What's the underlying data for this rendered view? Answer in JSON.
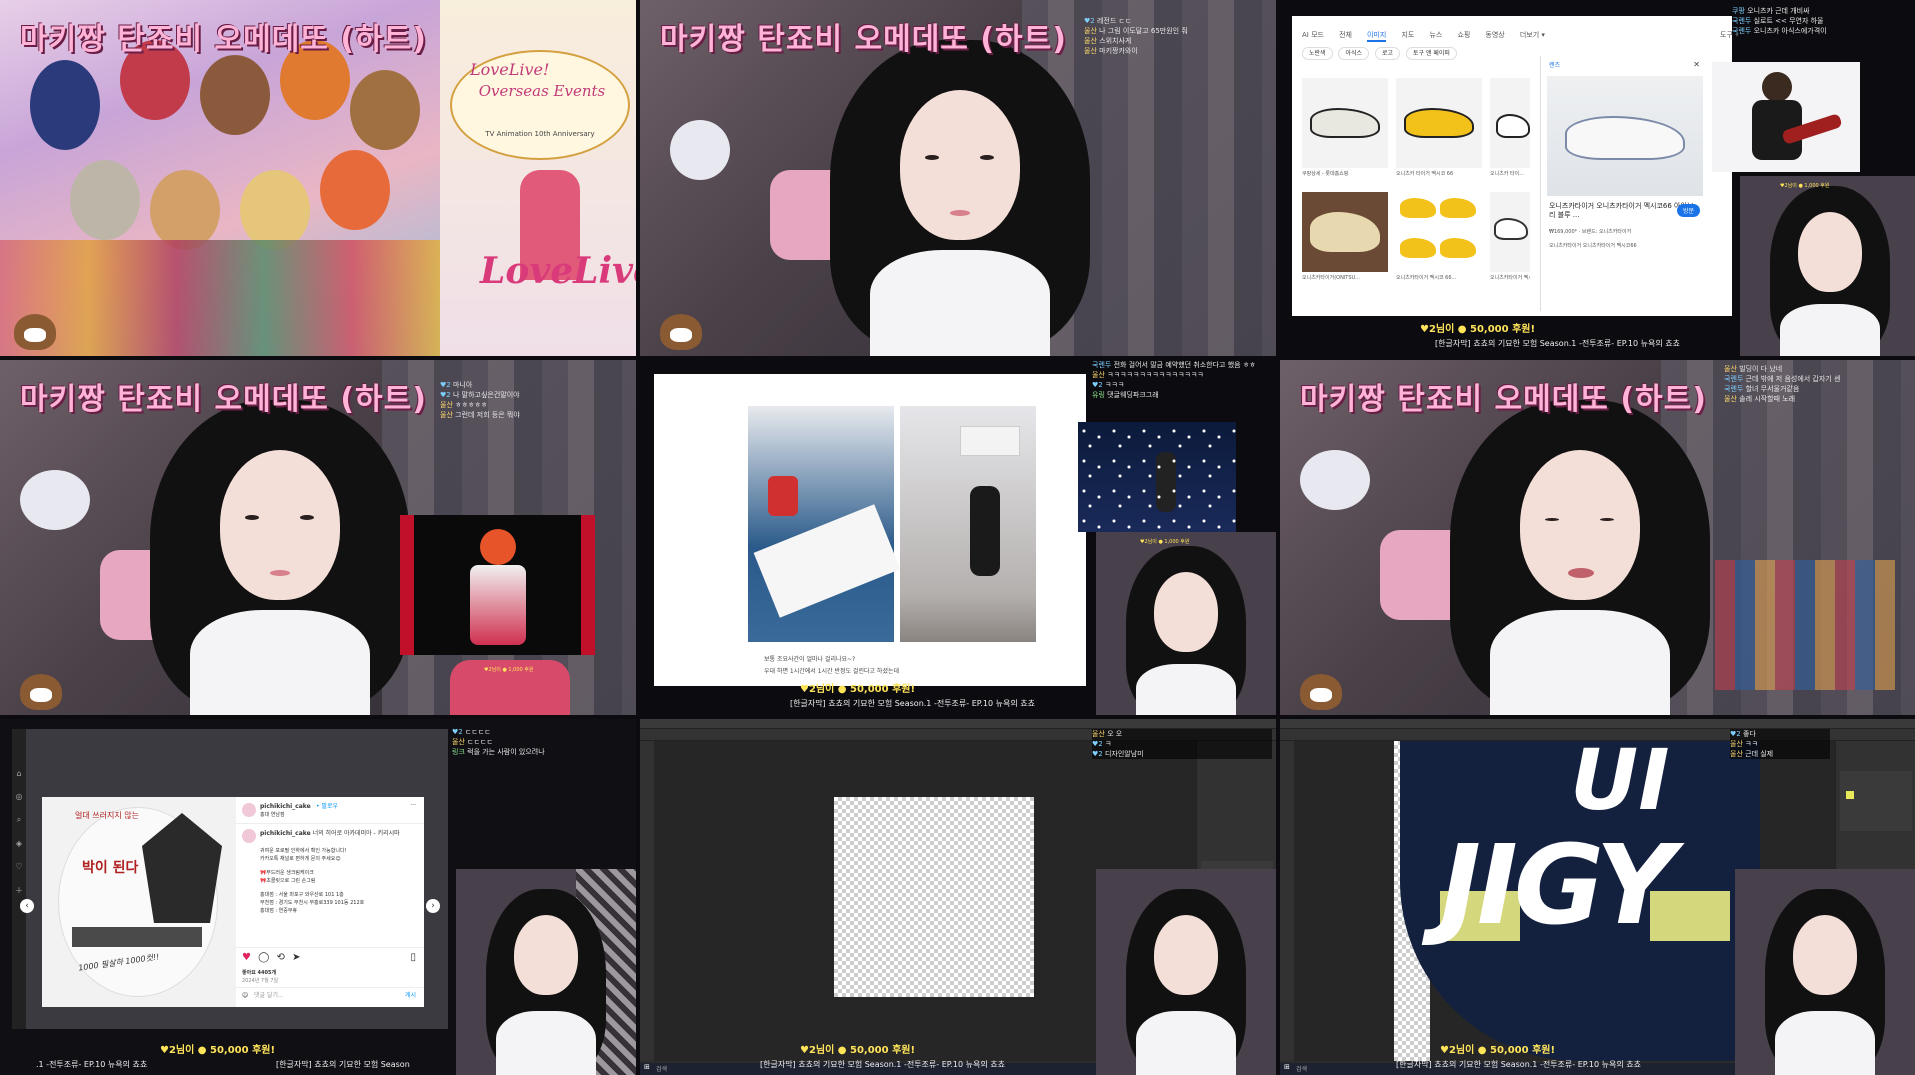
{
  "overlay_title": "마키짱 탄죠비 오메데또 (하트)",
  "donation": {
    "icon": "♥",
    "text": "♥2님이 ● 50,000 후원!",
    "small_text": "♥2님이 ● 1,000 후원"
  },
  "ticker": {
    "full": "[한글자막] 쵸쵸의 기묘한 모험 Season.1 -전투조류- EP.10 뉴욕의 쵸쵸",
    "partial_left": ".1 -전투조류- EP.10 뉴욕의 쵸쵸",
    "partial_right": "[한글자막] 쵸쵸의 기묘한 모험 Season"
  },
  "tile1": {
    "poster_title": "LoveLive!",
    "poster_sub": "Overseas Events",
    "poster_sub2": "TV Animation 10th Anniversary",
    "poster_bottom": "LoveLive!"
  },
  "tile2": {
    "chat": [
      {
        "nick": "♥2",
        "msg": "레전드 ㄷㄷ"
      },
      {
        "nick": "울산",
        "msg": "나 그림 이도달고 65만원인 줘"
      },
      {
        "nick": "울산",
        "msg": "스위치사게"
      },
      {
        "nick": "울산",
        "msg": "마키짱카와이"
      }
    ]
  },
  "tile3": {
    "search_tabs": [
      "AI 모드",
      "전체",
      "이미지",
      "지도",
      "뉴스",
      "쇼핑",
      "동영상",
      "더보기 ▾",
      "도구 ▾"
    ],
    "filter_chips": [
      "노란색",
      "아식스",
      "로고",
      "토구 앤 페이퍼"
    ],
    "product_title": "오니츠카타이거 오니츠카타이거 멕시코66 아이보리 블루 ...",
    "product_price": "₩169,000* · 브랜드: 오니츠카타이거",
    "product_btn": "방문",
    "lens_label": "렌즈",
    "lens_desc": "오니츠카타이거 오니츠카타이거 멕시코66",
    "tiles": [
      {
        "src": "쿠팡상세 · 롯데홈쇼핑",
        "label": "쿠팡상세 - 롯데홈쇼핑"
      },
      {
        "src": "KREAM",
        "label": "오니츠카 타이거 멕시코 66"
      },
      {
        "src": "KREAM",
        "label": "오니츠카 타이..."
      },
      {
        "src": "무신사",
        "label": "오니츠카타이거(ONITSU..."
      },
      {
        "src": "29CM",
        "label": "오니츠카타이거 멕시코 66..."
      },
      {
        "src": "무신사",
        "label": "오니츠카타이거 멕시코 66"
      }
    ],
    "chat": [
      {
        "nick": "쿠팡",
        "msg": "오니츠카 근데 개비싸"
      },
      {
        "nick": "국렌두",
        "msg": "실로트 << 무연자 하울"
      },
      {
        "nick": "국렌두",
        "msg": "오니츠카 아식스에가격이"
      }
    ]
  },
  "tile4": {
    "chat": [
      {
        "nick": "♥2",
        "msg": "마니아"
      },
      {
        "nick": "♥2",
        "msg": "나 말하고싶은건말이야"
      },
      {
        "nick": "울산",
        "msg": "ㅎㅎㅎㅎㅎ"
      },
      {
        "nick": "울산",
        "msg": "그런데 저희 등은 뭐야"
      }
    ]
  },
  "tile5": {
    "caption": "보통 조요사간이 얼마나 걸리나요~?",
    "caption2": "우대 하면 1시간에서 1시간 반정도 걸린다고 하셨는데",
    "chat": [
      {
        "nick": "국렌두",
        "msg": "전화 걸어서 말금 예약했던 취소한다고 했음 ㅎㅎ"
      },
      {
        "nick": "울산",
        "msg": "ㅋㅋㅋㅋㅋㅋㅋㅋㅋㅋㅋㅋㅋㅋㅋ"
      },
      {
        "nick": "♥2",
        "msg": "ㅋㅋㅋ"
      },
      {
        "nick": "유링",
        "msg": "댓글웨딩파크그래"
      }
    ]
  },
  "tile6": {
    "chat": [
      {
        "nick": "울산",
        "msg": "빌딩이 다 났네"
      },
      {
        "nick": "국렌두",
        "msg": "근데 밖에 저 음성에서 갑자기 센"
      },
      {
        "nick": "국렌두",
        "msg": "할녀 무서울거같음"
      },
      {
        "nick": "울산",
        "msg": "솔레 시작할때 노래"
      }
    ]
  },
  "tile7": {
    "ig_user": "pichikichi_cake",
    "ig_follow": "• 팔로우",
    "ig_sub": "홍대 연남점",
    "ig_caption_user": "pichikichi_cake",
    "ig_caption": "너의 히어로 아카데미아 - 키리시마",
    "ig_lines": [
      "귀여운 포로필 인하에서 확인 가능합니다!",
      "카카오톡 채널로 편하게 문의 주세요😊",
      "",
      "🎀부드러운 생크림케이크",
      "🎀초콜릿으로 그린 손그림",
      "",
      "홍대점 : 서울 마포구 와우산로 101 1층",
      "부천점 : 경기도 부천시 부흥로339 101동 212호",
      "홍대점 : 연중무휴"
    ],
    "ig_likes": "좋아요 4405개",
    "ig_date": "2024년 7월 7일",
    "ig_comment": "댓글 달기...",
    "ig_post_btn": "게시",
    "cake_text": "박이 된다",
    "cake_text2": "1000 필살하 1000컷!!",
    "cake_top": "얼대 쓰러지지 않는",
    "chat": [
      {
        "nick": "♥2",
        "msg": "ㄷㄷㄷㄷ"
      },
      {
        "nick": "울산",
        "msg": "ㄷㄷㄷㄷ"
      },
      {
        "nick": "링크",
        "msg": "럭을 가는 사람이 있으려나"
      }
    ]
  },
  "tile8": {
    "chat": [
      {
        "nick": "울산",
        "msg": "오 오"
      },
      {
        "nick": "♥2",
        "msg": "ㅋ"
      },
      {
        "nick": "♥2",
        "msg": "디자인알남미"
      }
    ],
    "taskbar_search": "검색"
  },
  "tile9": {
    "canvas_text1": "UI",
    "canvas_text2": "JIGY",
    "chat": [
      {
        "nick": "♥2",
        "msg": "좋다"
      },
      {
        "nick": "울산",
        "msg": "ㅋㅋ"
      },
      {
        "nick": "울산",
        "msg": "근데 실제"
      }
    ],
    "taskbar_search": "검색"
  },
  "colors": {
    "title_pink": "#ffb3d6",
    "donation_yellow": "#ffe45a",
    "chat_blue": "#7fd0ff"
  }
}
